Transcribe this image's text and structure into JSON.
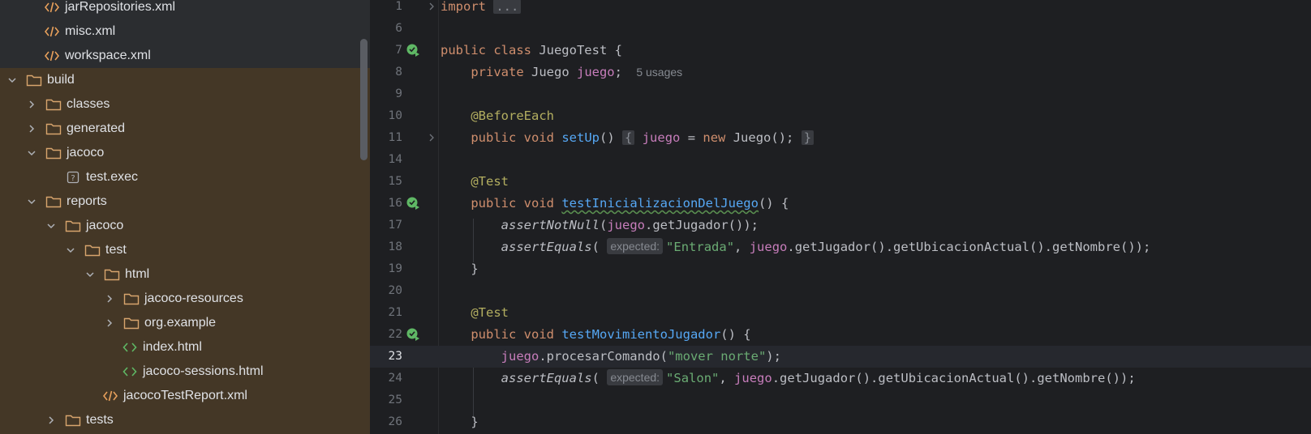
{
  "colors": {
    "sidebar_bg": "#2b2d30",
    "build_highlight": "#443726",
    "editor_bg": "#1e1f22",
    "keyword": "#cf8e6d",
    "field": "#c77dbb",
    "function": "#56a8f5",
    "annotation": "#b3ae60",
    "string": "#6aab73",
    "folder_icon": "#d8a56d",
    "xml_icon": "#e8a05b",
    "html_icon": "#5fb865",
    "run_icon": "#5fb865"
  },
  "tree": {
    "items": [
      {
        "label": "jarRepositories.xml",
        "icon": "xml-file-icon"
      },
      {
        "label": "misc.xml",
        "icon": "xml-file-icon"
      },
      {
        "label": "workspace.xml",
        "icon": "xml-file-icon"
      },
      {
        "label": "build",
        "icon": "folder-icon",
        "expanded": true
      },
      {
        "label": "classes",
        "icon": "folder-icon",
        "expanded": false
      },
      {
        "label": "generated",
        "icon": "folder-icon",
        "expanded": false
      },
      {
        "label": "jacoco",
        "icon": "folder-icon",
        "expanded": true
      },
      {
        "label": "test.exec",
        "icon": "unknown-file-icon"
      },
      {
        "label": "reports",
        "icon": "folder-icon",
        "expanded": true
      },
      {
        "label": "jacoco",
        "icon": "folder-icon",
        "expanded": true
      },
      {
        "label": "test",
        "icon": "folder-icon",
        "expanded": true
      },
      {
        "label": "html",
        "icon": "folder-icon",
        "expanded": true
      },
      {
        "label": "jacoco-resources",
        "icon": "folder-icon",
        "expanded": false
      },
      {
        "label": "org.example",
        "icon": "folder-icon",
        "expanded": false
      },
      {
        "label": "index.html",
        "icon": "html-file-icon"
      },
      {
        "label": "jacoco-sessions.html",
        "icon": "html-file-icon"
      },
      {
        "label": "jacocoTestReport.xml",
        "icon": "xml-file-icon"
      },
      {
        "label": "tests",
        "icon": "folder-icon",
        "expanded": false
      }
    ]
  },
  "editor": {
    "current_line": "23",
    "lines": [
      {
        "num": "1"
      },
      {
        "num": "6"
      },
      {
        "num": "7"
      },
      {
        "num": "8"
      },
      {
        "num": "9"
      },
      {
        "num": "10"
      },
      {
        "num": "11"
      },
      {
        "num": "14"
      },
      {
        "num": "15"
      },
      {
        "num": "16"
      },
      {
        "num": "17"
      },
      {
        "num": "18"
      },
      {
        "num": "19"
      },
      {
        "num": "20"
      },
      {
        "num": "21"
      },
      {
        "num": "22"
      },
      {
        "num": "23"
      },
      {
        "num": "24"
      },
      {
        "num": "25"
      },
      {
        "num": "26"
      }
    ],
    "code": {
      "l1_kw": "import",
      "l1_fold": "...",
      "l7_kw": "public class",
      "l7_rest": " JuegoTest {",
      "l8_kw": "private",
      "l8_type": " Juego ",
      "l8_field": "juego",
      "l8_semi": ";",
      "l8_hint": "5 usages",
      "l10_ann": "@BeforeEach",
      "l11_kw": "public void",
      "l11_fn": "setUp",
      "l11_paren": "()",
      "l11_open": "{",
      "l11_field": "juego",
      "l11_eq": " = ",
      "l11_new": "new",
      "l11_rest": " Juego();",
      "l11_close": "}",
      "l15_ann": "@Test",
      "l16_kw": "public void",
      "l16_fn": "testInicializacionDelJuego",
      "l16_rest": "() {",
      "l17_fn": "assertNotNull",
      "l17_open": "(",
      "l17_field": "juego",
      "l17_rest": ".getJugador());",
      "l18_fn": "assertEquals",
      "l18_open": "(",
      "l18_hint": "expected:",
      "l18_str": "\"Entrada\"",
      "l18_comma": ", ",
      "l18_field": "juego",
      "l18_rest": ".getJugador().getUbicacionActual().getNombre());",
      "l19_close": "}",
      "l21_ann": "@Test",
      "l22_kw": "public void",
      "l22_fn": "testMovimientoJugador",
      "l22_rest": "() {",
      "l23_field": "juego",
      "l23_mid": ".procesarComando(",
      "l23_str": "\"mover norte\"",
      "l23_rest": ");",
      "l24_fn": "assertEquals",
      "l24_open": "(",
      "l24_hint": "expected:",
      "l24_str": "\"Salon\"",
      "l24_comma": ", ",
      "l24_field": "juego",
      "l24_rest": ".getJugador().getUbicacionActual().getNombre());",
      "l26_close": "}"
    }
  }
}
